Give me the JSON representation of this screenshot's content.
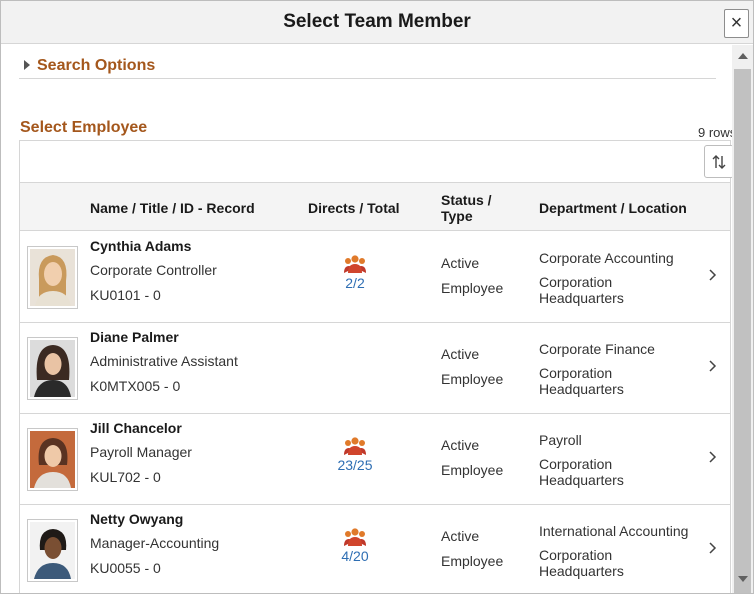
{
  "dialog": {
    "title": "Select Team Member",
    "close_label": "×"
  },
  "search_options": {
    "label": "Search Options"
  },
  "section": {
    "title": "Select Employee",
    "row_count": "9 rows"
  },
  "grid": {
    "headers": {
      "name": "Name / Title / ID - Record",
      "directs": "Directs / Total",
      "status_line1": "Status /",
      "status_line2": "Type",
      "department": "Department / Location"
    },
    "rows": [
      {
        "name": "Cynthia Adams",
        "title": "Corporate Controller",
        "id": "KU0101 - 0",
        "directs": "2/2",
        "status": "Active",
        "type": "Employee",
        "department": "Corporate Accounting",
        "location": "Corporation Headquarters"
      },
      {
        "name": "Diane Palmer",
        "title": "Administrative Assistant",
        "id": "K0MTX005 - 0",
        "directs": "",
        "status": "Active",
        "type": "Employee",
        "department": "Corporate Finance",
        "location": "Corporation Headquarters"
      },
      {
        "name": "Jill Chancelor",
        "title": "Payroll Manager",
        "id": "KUL702 - 0",
        "directs": "23/25",
        "status": "Active",
        "type": "Employee",
        "department": "Payroll",
        "location": "Corporation Headquarters"
      },
      {
        "name": "Netty Owyang",
        "title": "Manager-Accounting",
        "id": "KU0055 - 0",
        "directs": "4/20",
        "status": "Active",
        "type": "Employee",
        "department": "International Accounting",
        "location": "Corporation Headquarters"
      }
    ]
  },
  "colors": {
    "accent_orange": "#a4571c",
    "link_blue": "#2e6eb3",
    "team_icon": "#e07a2a"
  },
  "icons": {
    "close": "close-icon",
    "expand": "triangle-right-icon",
    "sort": "sort-arrows-icon",
    "team": "team-icon",
    "row_nav": "chevron-right-icon"
  }
}
